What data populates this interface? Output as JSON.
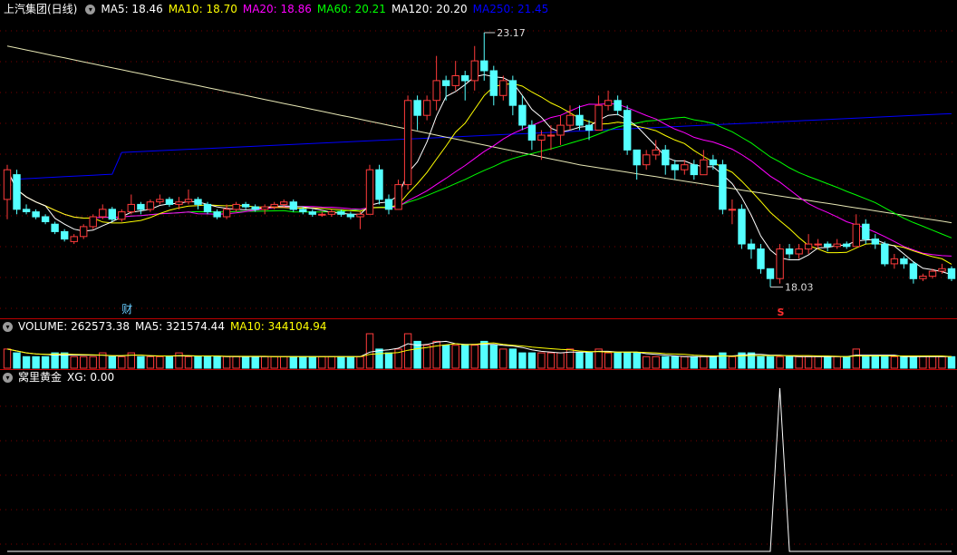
{
  "price_panel": {
    "title": "上汽集团(日线)",
    "ma": [
      {
        "label": "MA5: 18.46",
        "color": "#ffffff"
      },
      {
        "label": "MA10: 18.70",
        "color": "#ffff00"
      },
      {
        "label": "MA20: 18.86",
        "color": "#ff00ff"
      },
      {
        "label": "MA60: 20.21",
        "color": "#00ff00"
      },
      {
        "label": "MA120: 20.20",
        "color": "#ffffff"
      },
      {
        "label": "MA250: 21.45",
        "color": "#0000ff"
      }
    ],
    "high_label": "23.17",
    "low_label": "18.03",
    "signal_label": "S",
    "event_label": "财"
  },
  "volume_panel": {
    "name": "VOLUME: 262573.38",
    "ma5": "MA5: 321574.44",
    "ma10": "MA10: 344104.94"
  },
  "indicator_panel": {
    "name": "窝里黄金",
    "xg": "XG: 0.00"
  },
  "colors": {
    "up": "#ff3b3b",
    "down": "#54ffff",
    "grid": "#7a0000",
    "border": "#b40000",
    "ma5": "#ffffff",
    "ma10": "#ffff00",
    "ma20": "#ff00ff",
    "ma60": "#00ff00",
    "ma120": "#e6e6b4",
    "ma250": "#0000ff"
  },
  "chart_data": {
    "type": "candlestick",
    "price_range": [
      17.6,
      23.5
    ],
    "candles": [
      [
        19.8,
        20.4,
        20.5,
        19.4
      ],
      [
        20.3,
        19.6,
        20.4,
        19.5
      ],
      [
        19.6,
        19.55,
        19.7,
        19.5
      ],
      [
        19.55,
        19.45,
        19.6,
        19.4
      ],
      [
        19.45,
        19.35,
        19.5,
        19.3
      ],
      [
        19.3,
        19.15,
        19.35,
        19.1
      ],
      [
        19.15,
        19.0,
        19.2,
        18.95
      ],
      [
        18.95,
        19.05,
        19.1,
        18.9
      ],
      [
        19.05,
        19.25,
        19.3,
        19.0
      ],
      [
        19.25,
        19.45,
        19.5,
        19.2
      ],
      [
        19.45,
        19.6,
        19.7,
        19.4
      ],
      [
        19.6,
        19.4,
        19.65,
        19.35
      ],
      [
        19.4,
        19.55,
        19.6,
        19.35
      ],
      [
        19.55,
        19.7,
        19.9,
        19.5
      ],
      [
        19.7,
        19.6,
        19.75,
        19.5
      ],
      [
        19.6,
        19.75,
        19.8,
        19.55
      ],
      [
        19.75,
        19.8,
        19.9,
        19.7
      ],
      [
        19.8,
        19.7,
        19.85,
        19.65
      ],
      [
        19.7,
        19.75,
        19.85,
        19.6
      ],
      [
        19.75,
        19.8,
        20.0,
        19.7
      ],
      [
        19.8,
        19.7,
        19.85,
        19.6
      ],
      [
        19.7,
        19.55,
        19.75,
        19.5
      ],
      [
        19.55,
        19.45,
        19.6,
        19.4
      ],
      [
        19.45,
        19.6,
        19.7,
        19.4
      ],
      [
        19.6,
        19.7,
        19.75,
        19.55
      ],
      [
        19.7,
        19.65,
        19.75,
        19.6
      ],
      [
        19.65,
        19.6,
        19.7,
        19.55
      ],
      [
        19.6,
        19.65,
        19.7,
        19.5
      ],
      [
        19.65,
        19.7,
        19.75,
        19.6
      ],
      [
        19.7,
        19.75,
        19.8,
        19.65
      ],
      [
        19.75,
        19.6,
        19.8,
        19.55
      ],
      [
        19.6,
        19.55,
        19.65,
        19.5
      ],
      [
        19.55,
        19.5,
        19.6,
        19.45
      ],
      [
        19.5,
        19.5,
        19.55,
        19.45
      ],
      [
        19.5,
        19.55,
        19.6,
        19.45
      ],
      [
        19.55,
        19.5,
        19.6,
        19.45
      ],
      [
        19.5,
        19.45,
        19.55,
        19.4
      ],
      [
        19.45,
        19.5,
        19.55,
        19.2
      ],
      [
        19.5,
        20.4,
        20.5,
        19.5
      ],
      [
        20.4,
        19.8,
        20.5,
        19.7
      ],
      [
        19.8,
        19.6,
        19.9,
        19.5
      ],
      [
        19.6,
        20.1,
        20.2,
        19.6
      ],
      [
        20.1,
        21.8,
        21.9,
        20.0
      ],
      [
        21.8,
        21.5,
        21.9,
        21.2
      ],
      [
        21.5,
        21.8,
        21.9,
        21.4
      ],
      [
        21.8,
        22.2,
        22.7,
        21.6
      ],
      [
        22.2,
        22.1,
        22.3,
        21.8
      ],
      [
        22.1,
        22.3,
        22.6,
        22.0
      ],
      [
        22.3,
        22.2,
        22.4,
        21.8
      ],
      [
        22.2,
        22.6,
        22.9,
        22.0
      ],
      [
        22.6,
        22.4,
        23.17,
        22.2
      ],
      [
        22.4,
        21.9,
        22.5,
        21.7
      ],
      [
        21.9,
        22.2,
        22.3,
        21.8
      ],
      [
        22.2,
        21.7,
        22.3,
        21.5
      ],
      [
        21.7,
        21.3,
        21.9,
        21.2
      ],
      [
        21.3,
        21.0,
        21.4,
        20.8
      ],
      [
        21.0,
        21.1,
        21.2,
        20.6
      ],
      [
        21.1,
        21.1,
        21.3,
        20.8
      ],
      [
        21.1,
        21.3,
        21.5,
        20.9
      ],
      [
        21.3,
        21.5,
        21.7,
        21.2
      ],
      [
        21.5,
        21.3,
        21.7,
        21.2
      ],
      [
        21.3,
        21.2,
        21.4,
        21.0
      ],
      [
        21.2,
        21.7,
        21.9,
        21.2
      ],
      [
        21.7,
        21.8,
        22.0,
        21.6
      ],
      [
        21.8,
        21.6,
        21.9,
        21.5
      ],
      [
        21.6,
        20.8,
        21.7,
        20.7
      ],
      [
        20.8,
        20.5,
        20.8,
        20.2
      ],
      [
        20.5,
        20.7,
        20.8,
        20.4
      ],
      [
        20.7,
        20.8,
        21.0,
        20.6
      ],
      [
        20.8,
        20.5,
        20.9,
        20.3
      ],
      [
        20.5,
        20.4,
        20.6,
        20.2
      ],
      [
        20.4,
        20.5,
        20.6,
        20.3
      ],
      [
        20.5,
        20.3,
        20.6,
        20.2
      ],
      [
        20.3,
        20.6,
        20.8,
        20.3
      ],
      [
        20.6,
        20.5,
        20.7,
        20.4
      ],
      [
        20.5,
        19.6,
        20.6,
        19.5
      ],
      [
        19.6,
        19.6,
        19.8,
        19.3
      ],
      [
        19.6,
        18.9,
        19.7,
        18.8
      ],
      [
        18.9,
        18.8,
        19.0,
        18.6
      ],
      [
        18.8,
        18.4,
        18.9,
        18.3
      ],
      [
        18.4,
        18.2,
        18.4,
        18.03
      ],
      [
        18.2,
        18.8,
        18.9,
        18.1
      ],
      [
        18.8,
        18.7,
        18.9,
        18.6
      ],
      [
        18.7,
        18.8,
        18.9,
        18.6
      ],
      [
        18.8,
        18.9,
        19.1,
        18.7
      ],
      [
        18.9,
        18.9,
        19.0,
        18.8
      ],
      [
        18.9,
        18.85,
        18.95,
        18.75
      ],
      [
        18.85,
        18.9,
        19.0,
        18.8
      ],
      [
        18.9,
        18.85,
        18.95,
        18.8
      ],
      [
        18.85,
        19.3,
        19.5,
        18.85
      ],
      [
        19.3,
        19.0,
        19.4,
        18.9
      ],
      [
        19.0,
        18.9,
        19.1,
        18.8
      ],
      [
        18.9,
        18.5,
        18.95,
        18.45
      ],
      [
        18.5,
        18.6,
        18.7,
        18.4
      ],
      [
        18.6,
        18.5,
        18.65,
        18.4
      ],
      [
        18.5,
        18.2,
        18.55,
        18.1
      ],
      [
        18.2,
        18.25,
        18.3,
        18.15
      ],
      [
        18.25,
        18.35,
        18.4,
        18.2
      ],
      [
        18.35,
        18.4,
        18.5,
        18.3
      ],
      [
        18.4,
        18.2,
        18.45,
        18.15
      ]
    ],
    "volume": [
      5,
      4,
      3,
      3,
      3,
      4,
      4,
      3,
      3,
      3,
      4,
      3,
      3,
      4,
      3,
      3,
      3,
      3,
      4,
      3,
      3,
      3,
      3,
      3,
      3,
      3,
      3,
      3,
      3,
      3,
      3,
      3,
      3,
      3,
      3,
      3,
      3,
      3,
      9,
      5,
      4,
      5,
      9,
      7,
      6,
      7,
      6,
      6,
      6,
      6,
      7,
      6,
      5,
      5,
      4,
      4,
      4,
      4,
      4,
      5,
      4,
      4,
      5,
      4,
      4,
      4,
      4,
      3,
      3,
      3,
      3,
      3,
      3,
      3,
      3,
      4,
      3,
      4,
      4,
      3,
      3,
      3,
      3,
      3,
      3,
      3,
      3,
      3,
      3,
      5,
      3,
      3,
      3,
      3,
      3,
      3,
      3,
      3,
      3,
      3
    ],
    "xg_signal_index": 81
  }
}
